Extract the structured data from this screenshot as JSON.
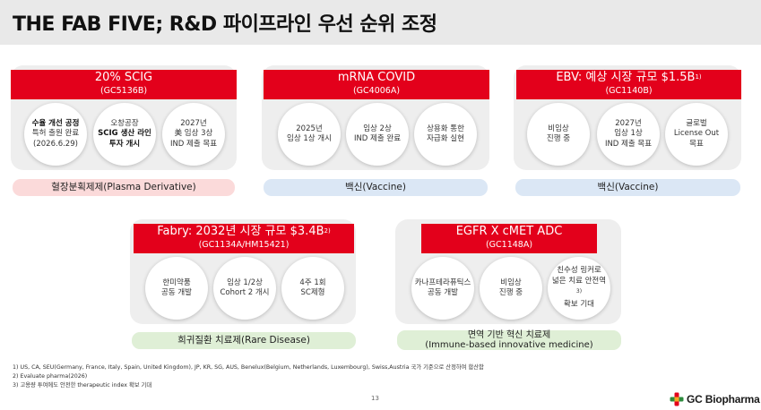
{
  "page": {
    "title": "THE FAB FIVE; R&D 파이프라인 우선 순위 조정",
    "page_number": "13",
    "logo_text": "GC Biopharma"
  },
  "cards": [
    {
      "title": "20% SCIG",
      "code": "(GC5136B)",
      "circles": [
        {
          "lines": [
            "수율 개선 공정",
            "특허 출원 완료",
            "(2026.6.29)"
          ]
        },
        {
          "lines": [
            "오창공장",
            "SCIG 생산 라인",
            "투자 개시"
          ]
        },
        {
          "lines": [
            "2027년",
            "美 임상 3상",
            "IND 제출 목표"
          ]
        }
      ],
      "category": "혈장분획제제(Plasma Derivative)"
    },
    {
      "title": "mRNA COVID",
      "code": "(GC4006A)",
      "circles": [
        {
          "lines": [
            "2025년",
            "임상 1상 개시"
          ]
        },
        {
          "lines": [
            "임상 2상",
            "IND 제출 완료"
          ]
        },
        {
          "lines": [
            "상용화 통한",
            "자급화 실현"
          ]
        }
      ],
      "category": "백신(Vaccine)"
    },
    {
      "title": "EBV: 예상 시장 규모 $1.5B",
      "title_sup": "1)",
      "code": "(GC1140B)",
      "circles": [
        {
          "lines": [
            "비임상",
            "진행 중"
          ]
        },
        {
          "lines": [
            "2027년",
            "임상 1상",
            "IND 제출 목표"
          ]
        },
        {
          "lines": [
            "글로벌",
            "License Out",
            "목표"
          ]
        }
      ],
      "category": "백신(Vaccine)"
    },
    {
      "title": "Fabry: 2032년 시장 규모 $3.4B",
      "title_sup": "2)",
      "code": "(GC1134A/HM15421)",
      "circles": [
        {
          "lines": [
            "한미약품",
            "공동 개발"
          ]
        },
        {
          "lines": [
            "임상 1/2상",
            "Cohort 2 개시"
          ]
        },
        {
          "lines": [
            "4주 1회",
            "SC제형"
          ]
        }
      ],
      "category": "희귀질환 치료제(Rare Disease)"
    },
    {
      "title": "EGFR X cMET ADC",
      "code": "(GC1148A)",
      "circles": [
        {
          "lines": [
            "카나프테라퓨틱스",
            "공동 개발"
          ]
        },
        {
          "lines": [
            "비임상",
            "진행 중"
          ]
        },
        {
          "lines": [
            "친수성 링커로",
            "넓은 치료 안전역",
            "확보 기대"
          ],
          "sup": "3)"
        }
      ],
      "category_lines": [
        "면역 기반 혁신 치료제",
        "(Immune-based innovative medicine)"
      ]
    }
  ],
  "footnotes": [
    "1) US, CA, SEU(Germany, France, Italy, Spain, United Kingdom), JP, KR, SG, AUS, Benelux(Belgium, Netherlands, Luxembourg), Swiss,Austria 국가 기준으로 산정하여 합산함",
    "2) Evaluate pharma(2026)",
    "3) 고용량 투여에도 안전한 therapeutic index 확보 기대"
  ],
  "colors": {
    "accent_red": "#e3001b",
    "card_bg": "#eeeeee",
    "pill_pink": "#fbdada",
    "pill_blue": "#dbe7f5",
    "pill_green": "#dfefd6"
  }
}
